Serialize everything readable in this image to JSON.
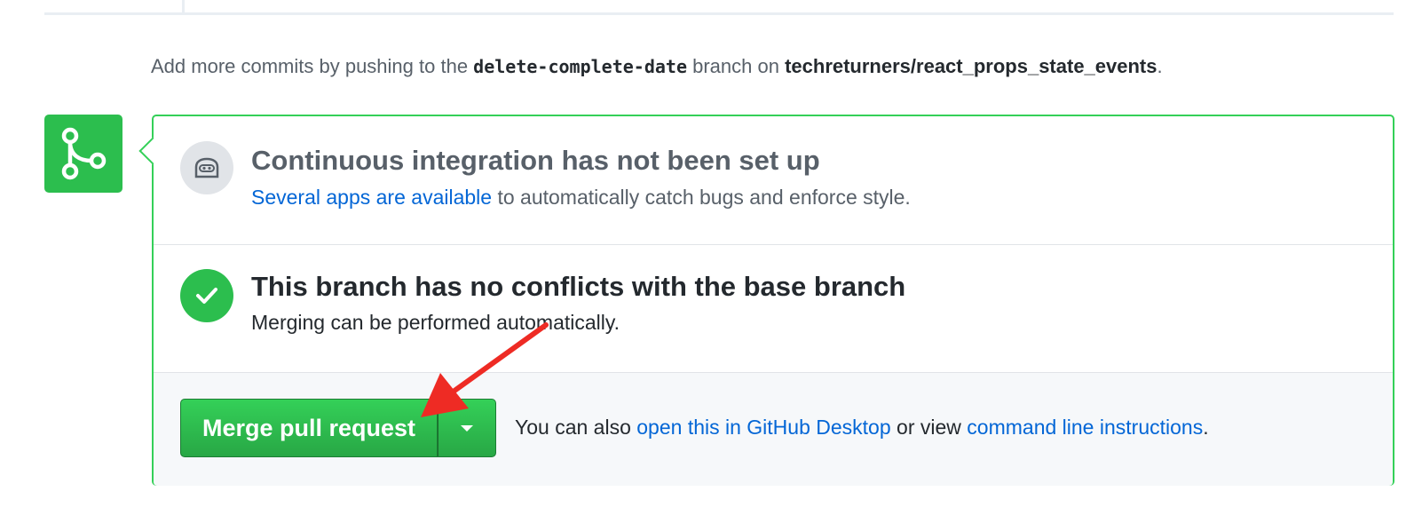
{
  "hint": {
    "prefix": "Add more commits by pushing to the ",
    "branch": "delete-complete-date",
    "middle": " branch on ",
    "repo": "techreturners/react_props_state_events",
    "suffix": "."
  },
  "ci_section": {
    "title": "Continuous integration has not been set up",
    "link": "Several apps are available",
    "desc_suffix": " to automatically catch bugs and enforce style."
  },
  "conflict_section": {
    "title": "This branch has no conflicts with the base branch",
    "desc": "Merging can be performed automatically."
  },
  "merge": {
    "button_label": "Merge pull request",
    "also_prefix": "You can also ",
    "desktop_link": "open this in GitHub Desktop",
    "also_middle": " or view ",
    "cli_link": "command line instructions",
    "also_suffix": "."
  },
  "colors": {
    "success_green": "#2cbe4e",
    "border_green": "#34d058",
    "link_blue": "#0366d6",
    "annotation_red": "#ee2b24"
  },
  "icons": [
    "git-merge-icon",
    "robot-icon",
    "check-icon",
    "triangle-down-icon",
    "annotation-arrow"
  ]
}
